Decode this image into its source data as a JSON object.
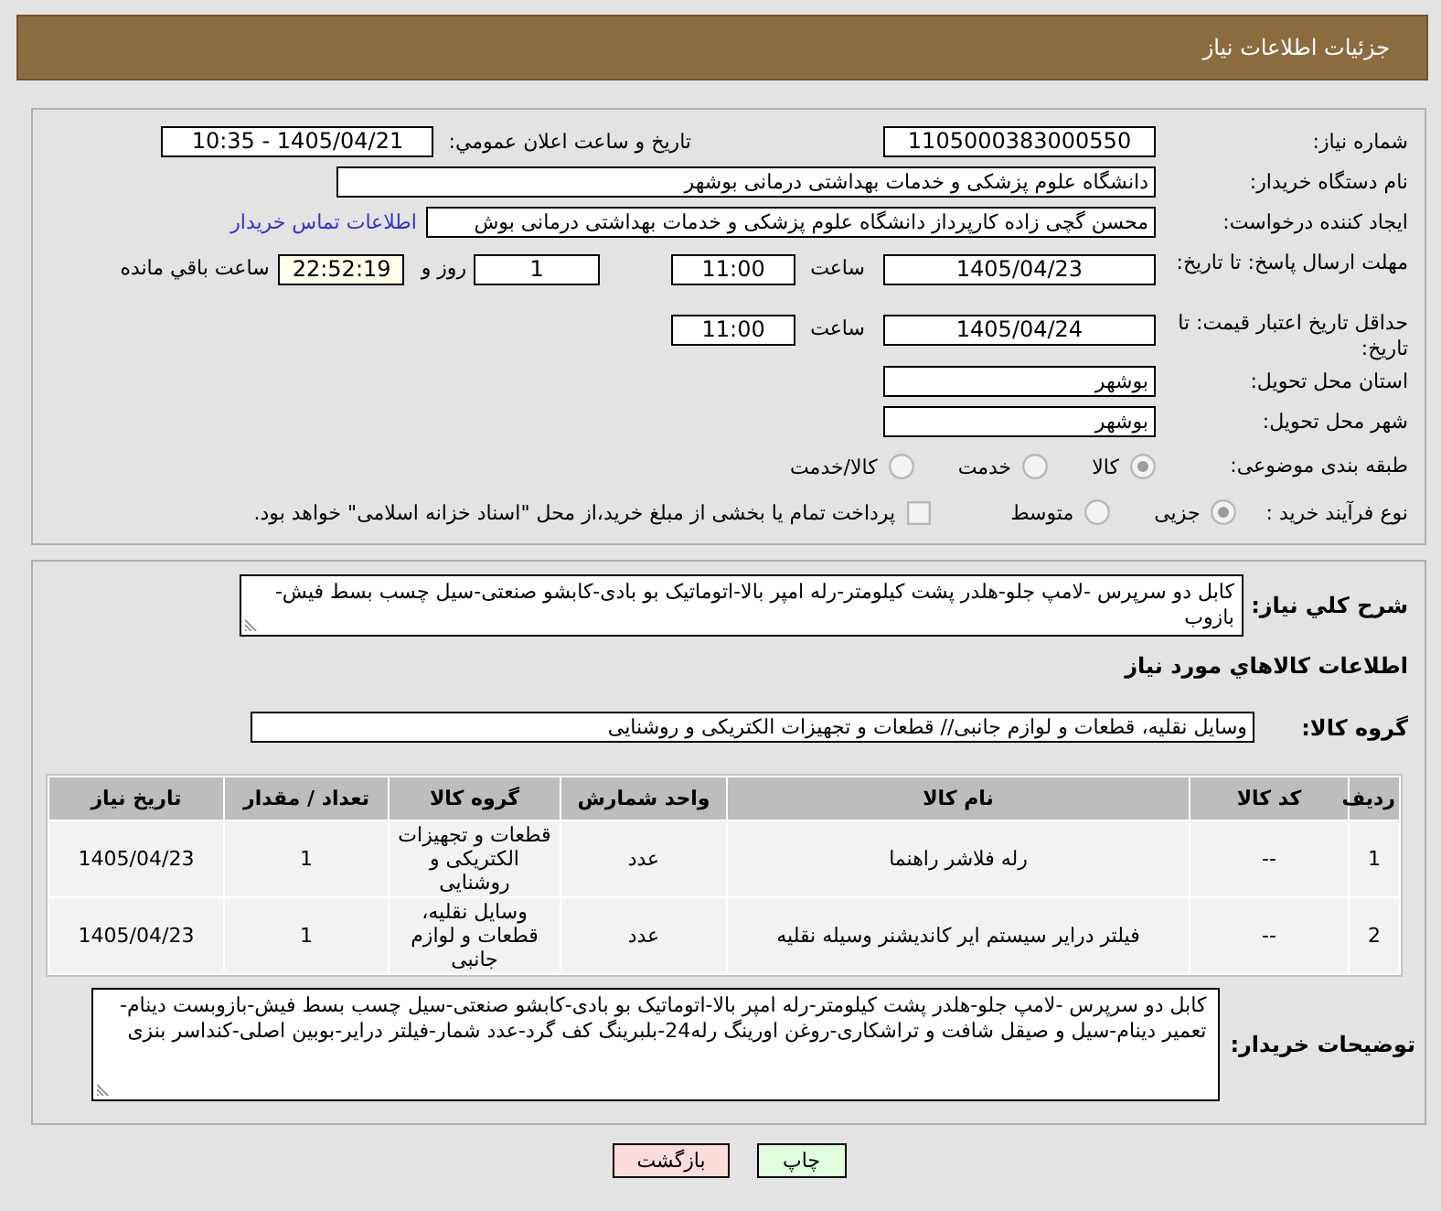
{
  "header": {
    "title": "جزئیات اطلاعات نیاز"
  },
  "need_number": {
    "label": "شماره نیاز:",
    "value": "1105000383000550"
  },
  "announce_datetime": {
    "label": "تاریخ و ساعت اعلان عمومي:",
    "value": "1405/04/21 - 10:35"
  },
  "buyer_org": {
    "label": "نام دستگاه خریدار:",
    "value": "دانشگاه علوم پزشکی و خدمات بهداشتی درمانی بوشهر"
  },
  "requester": {
    "label": "ایجاد کننده درخواست:",
    "value": "محسن گچی زاده کارپرداز دانشگاه علوم پزشکی و خدمات بهداشتی درمانی بوش",
    "contact_link": "اطلاعات تماس خریدار"
  },
  "reply_deadline": {
    "label": "مهلت ارسال پاسخ: تا تاریخ:",
    "date": "1405/04/23",
    "time_label": "ساعت",
    "time": "11:00",
    "days": "1",
    "days_label": "روز و",
    "remaining_time": "22:52:19",
    "remaining_label": "ساعت باقي مانده"
  },
  "price_validity": {
    "label": "حداقل تاریخ اعتبار قیمت: تا تاریخ:",
    "date": "1405/04/24",
    "time_label": "ساعت",
    "time": "11:00"
  },
  "delivery_province": {
    "label": "استان محل تحویل:",
    "value": "بوشهر"
  },
  "delivery_city": {
    "label": "شهر محل تحویل:",
    "value": "بوشهر"
  },
  "subject_category": {
    "label": "طبقه بندی موضوعی:",
    "options": [
      {
        "label": "کالا",
        "selected": true
      },
      {
        "label": "خدمت",
        "selected": false
      },
      {
        "label": "کالا/خدمت",
        "selected": false
      }
    ]
  },
  "purchase_process": {
    "label": "نوع فرآیند خرید :",
    "options": [
      {
        "label": "جزیی",
        "selected": true
      },
      {
        "label": "متوسط",
        "selected": false
      }
    ],
    "treasury_payment": {
      "label": "پرداخت تمام یا بخشی از مبلغ خرید،از محل \"اسناد خزانه اسلامی\" خواهد بود.",
      "checked": false
    }
  },
  "need_description": {
    "label": "شرح کلي نياز:",
    "value": "کابل دو سرپرس -لامپ جلو-هلدر پشت کیلومتر-رله امپر بالا-اتوماتیک بو بادی-کابشو صنعتی-سیل چسب بسط فیش-بازوب"
  },
  "goods_section_title": "اطلاعات کالاهاي مورد نياز",
  "goods_group": {
    "label": "گروه کالا:",
    "value": "وسایل نقلیه، قطعات و لوازم جانبی// قطعات و تجهیزات الکتریکی و روشنایی"
  },
  "table": {
    "columns": [
      "ردیف",
      "کد کالا",
      "نام کالا",
      "واحد شمارش",
      "گروه کالا",
      "تعداد / مقدار",
      "تاریخ نیاز"
    ],
    "rows": [
      [
        "1",
        "--",
        "رله فلاشر راهنما",
        "عدد",
        "قطعات و تجهیزات الکتریکی و روشنایی",
        "1",
        "1405/04/23"
      ],
      [
        "2",
        "--",
        "فیلتر درایر سیستم ایر کاندیشنر وسیله نقلیه",
        "عدد",
        "وسایل نقلیه، قطعات و لوازم جانبی",
        "1",
        "1405/04/23"
      ]
    ]
  },
  "buyer_notes": {
    "label": "توضیحات خریدار:",
    "value": "کابل دو سرپرس -لامپ جلو-هلدر پشت کیلومتر-رله امپر بالا-اتوماتیک بو بادی-کابشو صنعتی-سیل چسب بسط فیش-بازوبست دینام-تعمیر دینام-سیل و صیقل شافت و تراشکاری-روغن اورینگ رله24-بلبرینگ کف گرد-عدد شمار-فیلتر درایر-بوبین اصلی-کنداسر بنزی"
  },
  "buttons": [
    {
      "label": "چاپ",
      "kind": "print"
    },
    {
      "label": "بازگشت",
      "kind": "back"
    }
  ]
}
